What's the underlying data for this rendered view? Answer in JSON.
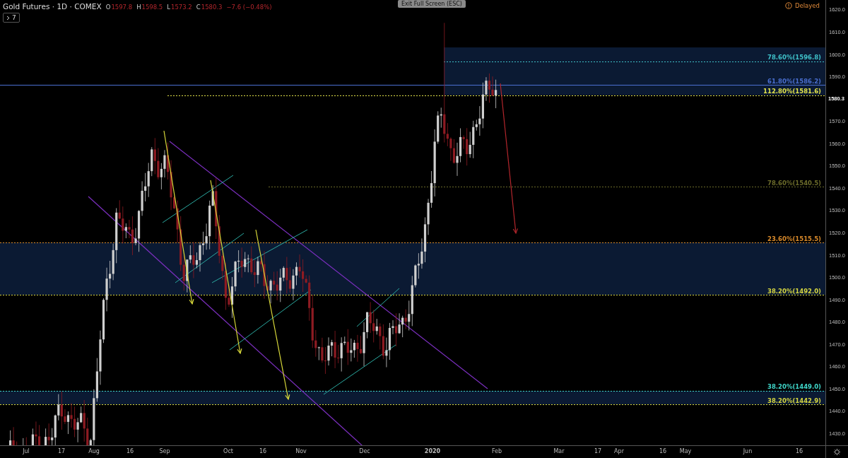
{
  "header": {
    "symbol": "Gold Futures · 1D · COMEX",
    "ohlc": [
      {
        "key": "O",
        "value": "1597.8"
      },
      {
        "key": "H",
        "value": "1598.5"
      },
      {
        "key": "L",
        "value": "1573.2"
      },
      {
        "key": "C",
        "value": "1580.3"
      }
    ],
    "change": "−7.6 (−0.48%)",
    "indicators_count": "7"
  },
  "exit_fullscreen": "Exit Full Screen (ESC)",
  "status": "Delayed",
  "fib_levels": [
    {
      "label": "78.60%(1596.8)",
      "color": "#3fc1c9"
    },
    {
      "label": "61.80%(1586.2)",
      "color": "#4a6fd0"
    },
    {
      "label": "112.80%(1581.6)",
      "color": "#e3e34a"
    },
    {
      "label": "78.60%(1540.5)",
      "color": "#6b6b2a"
    },
    {
      "label": "23.60%(1515.5)",
      "color": "#d98a2b"
    },
    {
      "label": "38.20%(1492.0)",
      "color": "#d6d640"
    },
    {
      "label": "38.20%(1449.0)",
      "color": "#3fd6c9"
    },
    {
      "label": "38.20%(1442.9)",
      "color": "#d6d640"
    }
  ],
  "price_axis": {
    "labels": [
      "1620.0",
      "1610.0",
      "1600.0",
      "1590.0",
      "1570.0",
      "1560.0",
      "1550.0",
      "1540.0",
      "1530.0",
      "1520.0",
      "1510.0",
      "1500.0",
      "1490.0",
      "1480.0",
      "1470.0",
      "1460.0",
      "1450.0",
      "1440.0",
      "1430.0"
    ],
    "last_price": "1580.3"
  },
  "time_axis": {
    "labels": [
      "Jul",
      "17",
      "Aug",
      "16",
      "Sep",
      "Oct",
      "16",
      "Nov",
      "Dec",
      "2020",
      "Feb",
      "Mar",
      "17",
      "Apr",
      "16",
      "May",
      "Jun",
      "16"
    ]
  }
}
